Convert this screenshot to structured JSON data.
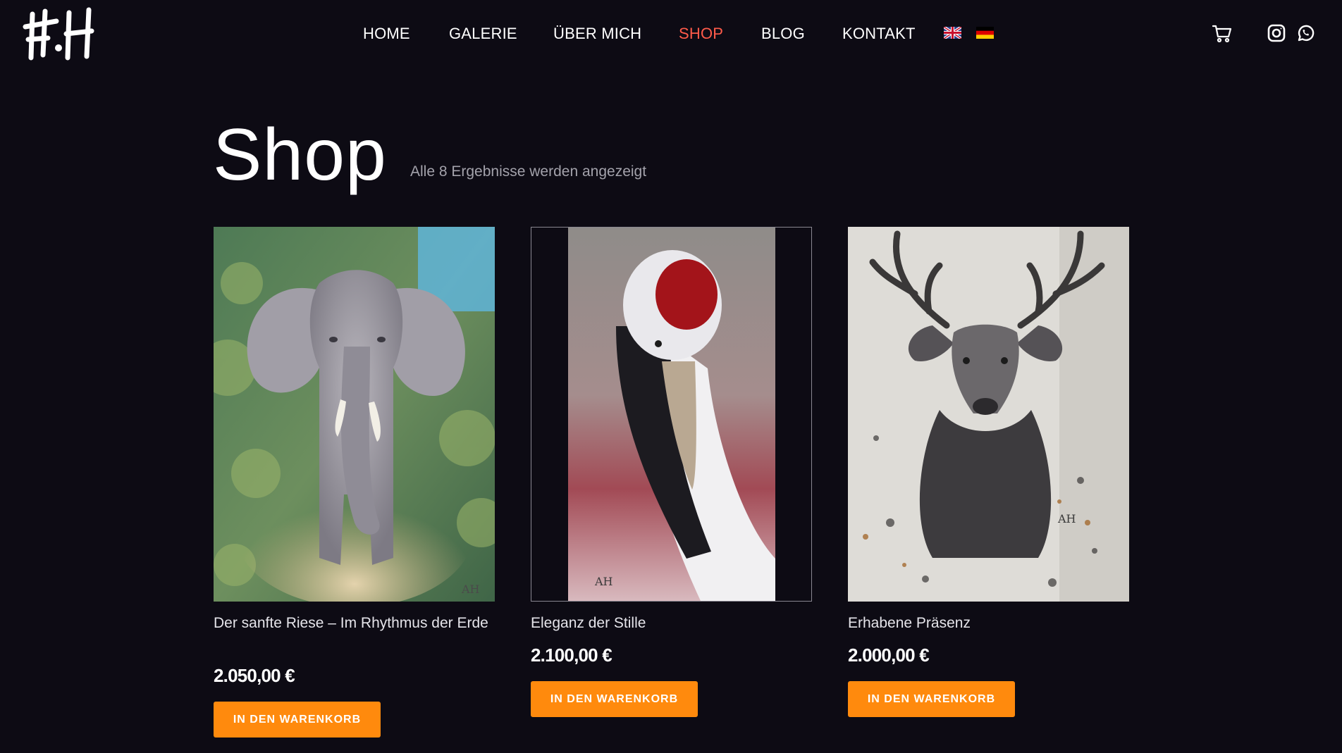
{
  "brand": {
    "logo_text": "A.H"
  },
  "nav": {
    "items": [
      {
        "label": "HOME",
        "active": false
      },
      {
        "label": "GALERIE",
        "active": false
      },
      {
        "label": "ÜBER MICH",
        "active": false
      },
      {
        "label": "SHOP",
        "active": true
      },
      {
        "label": "BLOG",
        "active": false
      },
      {
        "label": "KONTAKT",
        "active": false
      }
    ],
    "languages": [
      "English",
      "Deutsch"
    ],
    "icons": [
      "cart-icon",
      "instagram-icon",
      "whatsapp-icon"
    ]
  },
  "page": {
    "title": "Shop",
    "result_count": "Alle 8 Ergebnisse werden angezeigt"
  },
  "products": [
    {
      "title": "Der sanfte Riese – Im Rhythmus der Erde",
      "price": "2.050,00 €",
      "button": "IN DEN WARENKORB"
    },
    {
      "title": "Eleganz der Stille",
      "price": "2.100,00 €",
      "button": "IN DEN WARENKORB"
    },
    {
      "title": "Erhabene Präsenz",
      "price": "2.000,00 €",
      "button": "IN DEN WARENKORB"
    }
  ],
  "colors": {
    "background": "#0d0b14",
    "nav_active": "#ff5b4a",
    "button": "#ff8a0d"
  }
}
